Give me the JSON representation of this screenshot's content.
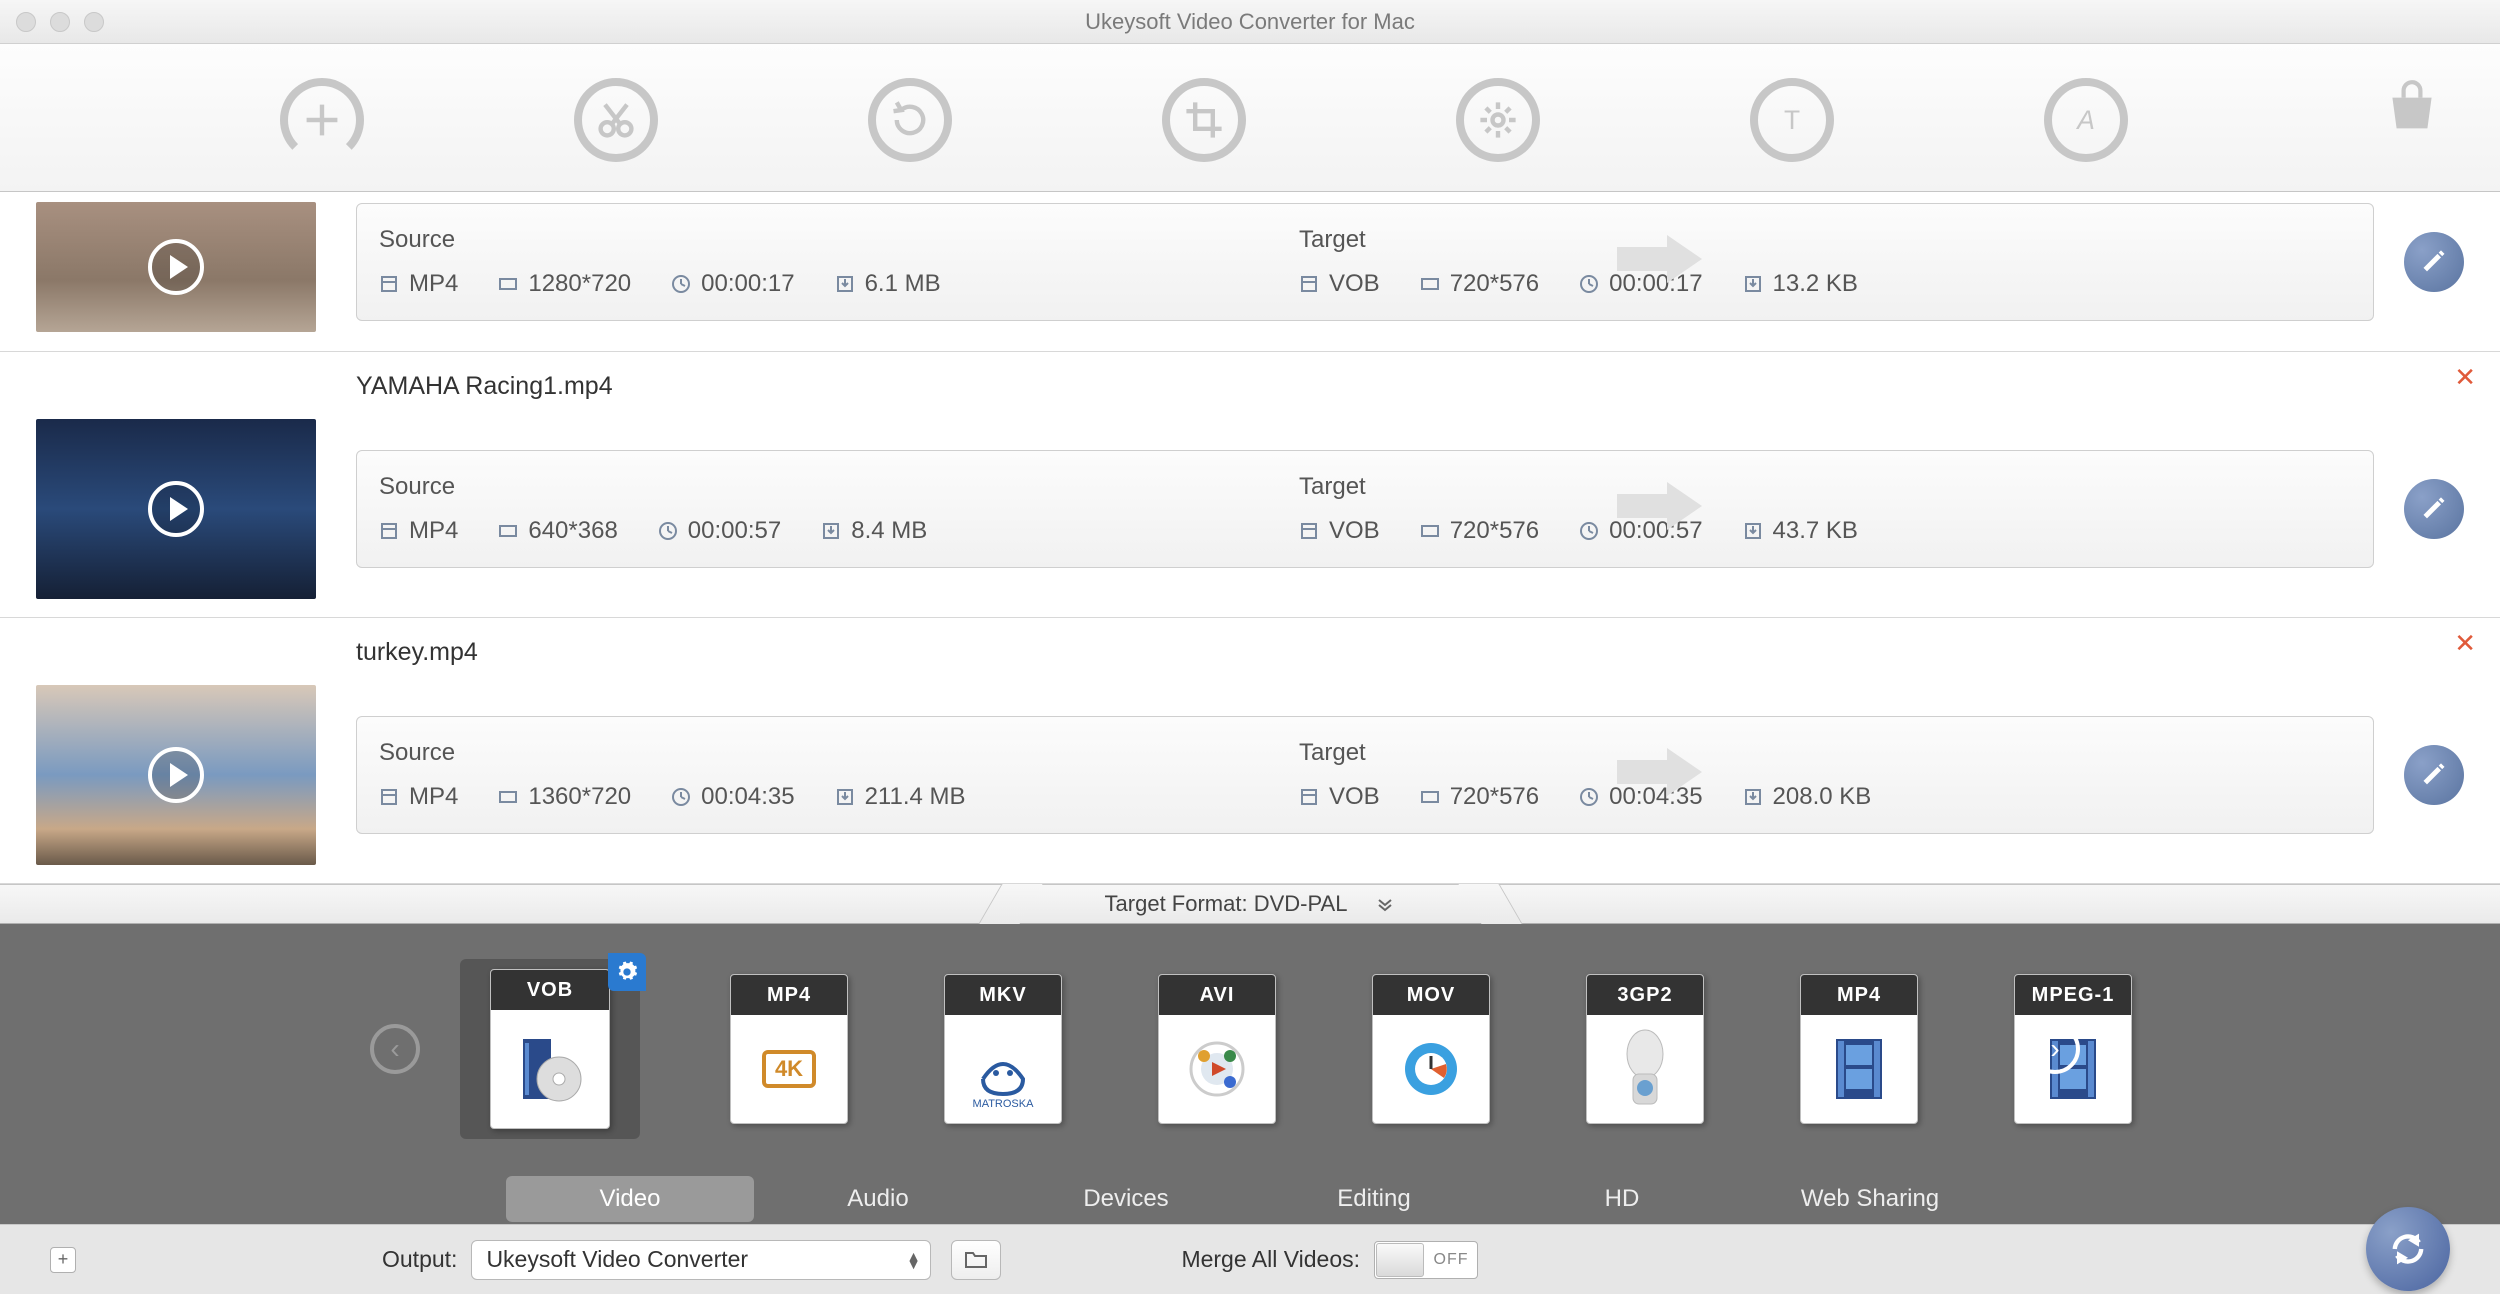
{
  "window": {
    "title": "Ukeysoft Video Converter for Mac"
  },
  "toolbar": {
    "buttons": [
      "add",
      "trim",
      "rotate",
      "crop",
      "effect",
      "watermark",
      "subtitle"
    ],
    "store": "store"
  },
  "labels": {
    "source": "Source",
    "target": "Target"
  },
  "items": [
    {
      "filename": "",
      "thumb_class": "balloon",
      "source": {
        "format": "MP4",
        "resolution": "1280*720",
        "duration": "00:00:17",
        "size": "6.1 MB"
      },
      "target": {
        "format": "VOB",
        "resolution": "720*576",
        "duration": "00:00:17",
        "size": "13.2 KB"
      }
    },
    {
      "filename": "YAMAHA Racing1.mp4",
      "thumb_class": "yamaha",
      "source": {
        "format": "MP4",
        "resolution": "640*368",
        "duration": "00:00:57",
        "size": "8.4 MB"
      },
      "target": {
        "format": "VOB",
        "resolution": "720*576",
        "duration": "00:00:57",
        "size": "43.7 KB"
      }
    },
    {
      "filename": "turkey.mp4",
      "thumb_class": "turkey",
      "source": {
        "format": "MP4",
        "resolution": "1360*720",
        "duration": "00:04:35",
        "size": "211.4 MB"
      },
      "target": {
        "format": "VOB",
        "resolution": "720*576",
        "duration": "00:04:35",
        "size": "208.0 KB"
      }
    }
  ],
  "target_format": {
    "label": "Target Format: DVD-PAL"
  },
  "formats": [
    {
      "name": "VOB",
      "selected": true,
      "sub": "disc"
    },
    {
      "name": "MP4",
      "sub": "4K"
    },
    {
      "name": "MKV",
      "sub": "matroska"
    },
    {
      "name": "AVI",
      "sub": "media"
    },
    {
      "name": "MOV",
      "sub": "qt"
    },
    {
      "name": "3GP2",
      "sub": "mobile"
    },
    {
      "name": "MP4",
      "sub": "film"
    },
    {
      "name": "MPEG-1",
      "sub": "film"
    }
  ],
  "category_tabs": [
    {
      "label": "Video",
      "active": true
    },
    {
      "label": "Audio"
    },
    {
      "label": "Devices"
    },
    {
      "label": "Editing"
    },
    {
      "label": "HD"
    },
    {
      "label": "Web Sharing"
    }
  ],
  "output": {
    "label": "Output:",
    "value": "Ukeysoft Video Converter"
  },
  "merge": {
    "label": "Merge All Videos:",
    "state": "OFF"
  }
}
